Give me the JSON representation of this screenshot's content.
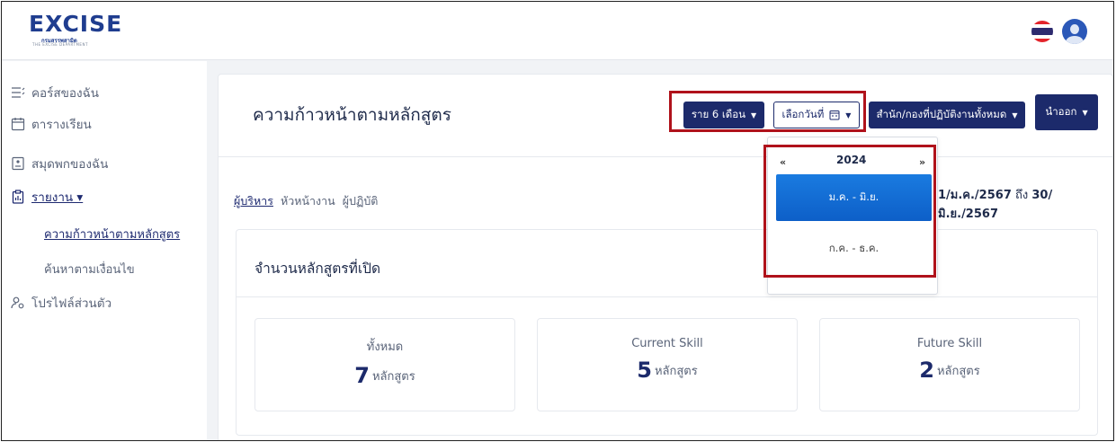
{
  "header": {
    "logo_main": "EXCISE",
    "logo_sub_th": "กรมสรรพสามิต",
    "logo_sub_en": "THE EXCISE DEPARTMENT",
    "flag_colors": [
      "#e3242b",
      "#ffffff",
      "#2d2a6e",
      "#ffffff",
      "#e3242b"
    ]
  },
  "sidebar": {
    "items": [
      {
        "label": "คอร์สของฉัน",
        "icon": "list-icon"
      },
      {
        "label": "ตารางเรียน",
        "icon": "calendar-icon"
      },
      {
        "label": "สมุดพกของฉัน",
        "icon": "notebook-icon"
      },
      {
        "label": "รายงาน ▾",
        "icon": "clipboard-report-icon"
      },
      {
        "label": "โปรไฟล์ส่วนตัว",
        "icon": "user-gear-icon"
      }
    ],
    "sub_items": [
      "ความก้าวหน้าตามหลักสูตร",
      "ค้นหาตามเงื่อนไข"
    ]
  },
  "main": {
    "title": "ความก้าวหน้าตามหลักสูตร",
    "buttons": {
      "period": "ราย 6 เดือน",
      "pick_date": "เลือกวันที่",
      "office": "สำนัก/กองที่ปฏิบัติงานทั้งหมด",
      "export": "นำออก"
    },
    "tabs": [
      "ผู้บริหาร",
      "หัวหน้างาน",
      "ผู้ปฏิบัติ"
    ],
    "range": {
      "start": "1/ม.ค./2567",
      "mid": "ถึง",
      "end": "30/มิ.ย./2567"
    },
    "section_title": "จำนวนหลักสูตรที่เปิด",
    "stats": [
      {
        "label": "ทั้งหมด",
        "value": "7",
        "unit": "หลักสูตร"
      },
      {
        "label": "Current Skill",
        "value": "5",
        "unit": "หลักสูตร"
      },
      {
        "label": "Future Skill",
        "value": "2",
        "unit": "หลักสูตร"
      }
    ]
  },
  "dropdown": {
    "prev": "«",
    "year": "2024",
    "next": "»",
    "options": [
      "ม.ค.  -  มิ.ย.",
      "ก.ค.  -  ธ.ค."
    ]
  },
  "highlight_color": "#b0121b"
}
